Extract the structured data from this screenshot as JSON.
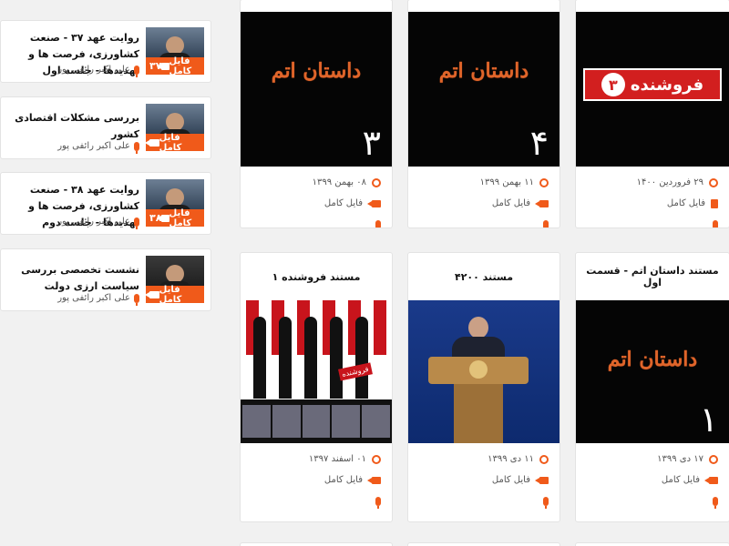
{
  "sidebar": {
    "items": [
      {
        "title": "روایت عهد ۳۷ - صنعت کشاورزی، فرصت ها و تهدیدها - جلسه اول",
        "author": "علی اکبر رائفی پور",
        "badge": "فایل کامل",
        "num": "۳۷"
      },
      {
        "title": "بررسی مشکلات اقتصادی کشور",
        "author": "علی اکبر رائفی پور",
        "badge": "فایل کامل",
        "num": ""
      },
      {
        "title": "روایت عهد ۳۸ - صنعت کشاورزی، فرصت ها و تهدیدها - جلسه دوم",
        "author": "علی اکبر رائفی پور",
        "badge": "فایل کامل",
        "num": "۳۸"
      },
      {
        "title": "نشست تخصصی بررسی سیاست ارزی دولت",
        "author": "علی اکبر رائفی پور",
        "badge": "فایل کامل",
        "num": ""
      }
    ]
  },
  "grid": {
    "row1": [
      {
        "art_text": "داستان اتم",
        "episode": "۳",
        "date": "۰۸ بهمن ۱۳۹۹",
        "file_label": "فایل کامل"
      },
      {
        "art_text": "داستان اتم",
        "episode": "۴",
        "date": "۱۱ بهمن ۱۳۹۹",
        "file_label": "فایل کامل"
      },
      {
        "art_text": "فروشنده",
        "episode": "۳",
        "date": "۲۹ فروردین ۱۴۰۰",
        "file_label": "فایل کامل"
      }
    ],
    "row2": [
      {
        "title": "مستند فروشنده ۱",
        "art_tag": "فروشنده",
        "date": "۰۱ اسفند ۱۳۹۷",
        "file_label": "فایل کامل"
      },
      {
        "title": "مستند ۴۲۰۰",
        "date": "۱۱ دی ۱۳۹۹",
        "file_label": "فایل کامل"
      },
      {
        "title": "مستند داستان اتم - قسمت اول",
        "art_text": "داستان اتم",
        "episode": "۱",
        "date": "۱۷ دی ۱۳۹۹",
        "file_label": "فایل کامل"
      }
    ]
  },
  "colors": {
    "accent": "#f05a1a",
    "banner_red": "#d21f1f"
  },
  "icons": {
    "video": "video-camera-icon",
    "audio": "microphone-icon",
    "date": "clock-icon",
    "document": "document-icon"
  }
}
